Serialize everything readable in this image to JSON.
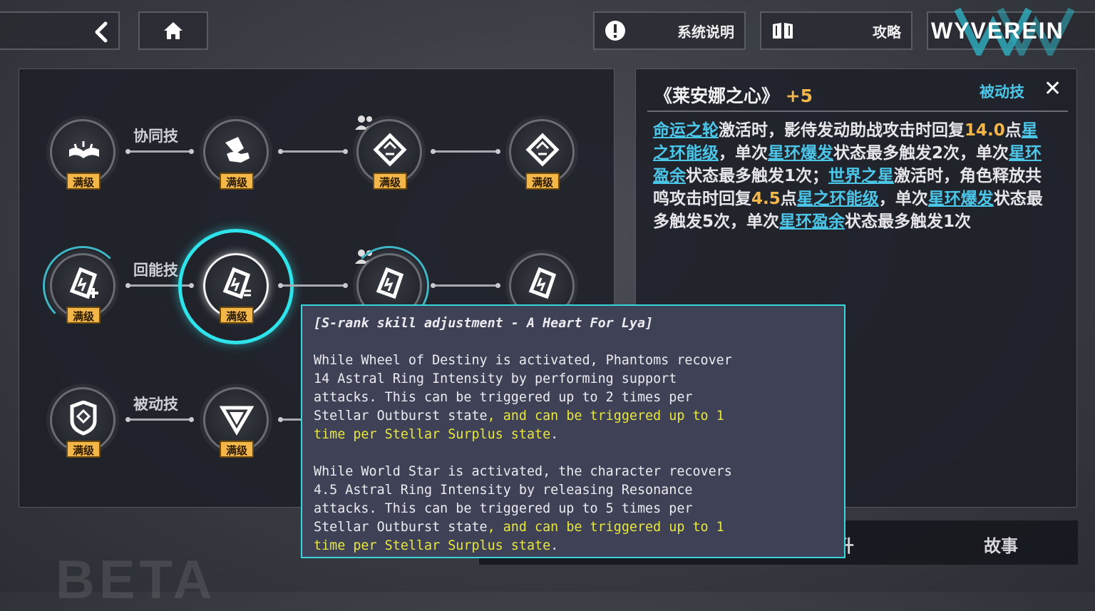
{
  "topbar": {
    "system_label": "系统说明",
    "guide_label": "攻略",
    "logo_text": "WYVEREIN"
  },
  "skills": {
    "badge": "满级",
    "row_labels": [
      "协同技",
      "回能技",
      "被动技"
    ]
  },
  "detail": {
    "title_name": "《莱安娜之心》",
    "title_level": "+5",
    "type": "被动技",
    "close_icon": "✕",
    "segments": [
      {
        "t": "命运之轮",
        "k": "kw"
      },
      {
        "t": "激活时，影侍发动助战攻击时回复",
        "k": ""
      },
      {
        "t": "14.0",
        "k": "num"
      },
      {
        "t": "点",
        "k": ""
      },
      {
        "t": "星之环能级",
        "k": "kw"
      },
      {
        "t": "，单次",
        "k": ""
      },
      {
        "t": "星环爆发",
        "k": "kw"
      },
      {
        "t": "状态最多触发2次，单次",
        "k": ""
      },
      {
        "t": "星环盈余",
        "k": "kw"
      },
      {
        "t": "状态最多触发1次；",
        "k": ""
      },
      {
        "t": "世界之星",
        "k": "kw"
      },
      {
        "t": "激活时，角色释放共鸣攻击时回复",
        "k": ""
      },
      {
        "t": "4.5",
        "k": "num"
      },
      {
        "t": "点",
        "k": ""
      },
      {
        "t": "星之环能级",
        "k": "kw"
      },
      {
        "t": "，单次",
        "k": ""
      },
      {
        "t": "星环爆发",
        "k": "kw"
      },
      {
        "t": "状态最多触发5次，单次",
        "k": ""
      },
      {
        "t": "星环盈余",
        "k": "kw"
      },
      {
        "t": "状态最多触发1次",
        "k": ""
      }
    ]
  },
  "bottom_tabs": [
    "升",
    "故事"
  ],
  "watermark": "BETA",
  "tooltip": {
    "title": "[S-rank skill adjustment - A Heart For Lya]",
    "para1_main": "While Wheel of Destiny is activated, Phantoms recover\n14 Astral Ring Intensity by performing support\nattacks. This can be triggered up to 2 times per\nStellar Outburst state",
    "para1_hl": ", and can be triggered up to 1\ntime per Stellar Surplus state",
    "para2_main": "While World Star is activated, the character recovers\n4.5 Astral Ring Intensity by releasing Resonance\nattacks. This can be triggered up to 5 times per\nStellar Outburst state",
    "para2_hl": ", and can be triggered up to 1\ntime per Stellar Surplus state",
    "period": "."
  },
  "colors": {
    "accent_cyan": "#2fe3ea",
    "keyword_blue": "#4cc6e8",
    "level_gold": "#f3b648",
    "highlight_yellow": "#e8e83c"
  }
}
